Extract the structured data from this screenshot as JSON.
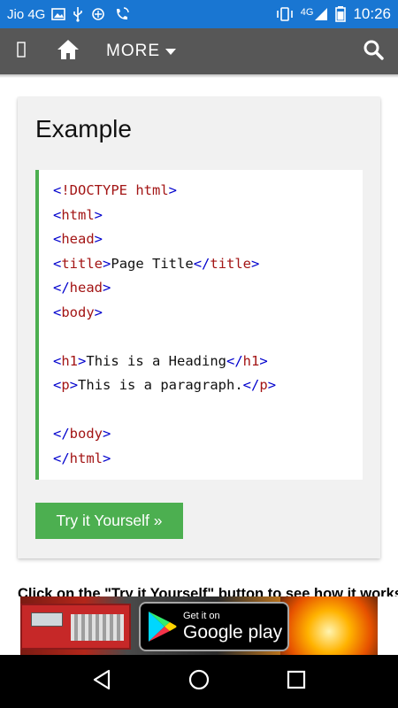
{
  "status_bar": {
    "carrier": "Jio 4G",
    "network": "4G",
    "time": "10:26",
    "icons": [
      "image-icon",
      "usb-icon",
      "wifi-calling-icon",
      "phone-wifi-icon",
      "vibrate-icon",
      "signal-icon",
      "battery-icon"
    ]
  },
  "navbar": {
    "menu_icon": "menu-icon",
    "home_icon": "home-icon",
    "more_label": "MORE",
    "search_icon": "search-icon"
  },
  "example": {
    "title": "Example",
    "code_lines": [
      "<!DOCTYPE html>",
      "<html>",
      "<head>",
      "<title>Page Title</title>",
      "</head>",
      "<body>",
      "",
      "<h1>This is a Heading</h1>",
      "<p>This is a paragraph.</p>",
      "",
      "</body>",
      "</html>"
    ],
    "button_label": "Try it Yourself »"
  },
  "instruction_text": "Click on the \"Try it Yourself\" button to see how it works.",
  "ad": {
    "get_it_on": "Get it on",
    "store_name": "Google play"
  },
  "colors": {
    "status_bar": "#1976d2",
    "navbar": "#575757",
    "accent_green": "#4caf50",
    "card_bg": "#f1f1f1",
    "code_tag": "#a31515",
    "code_bracket": "#0000cd"
  }
}
